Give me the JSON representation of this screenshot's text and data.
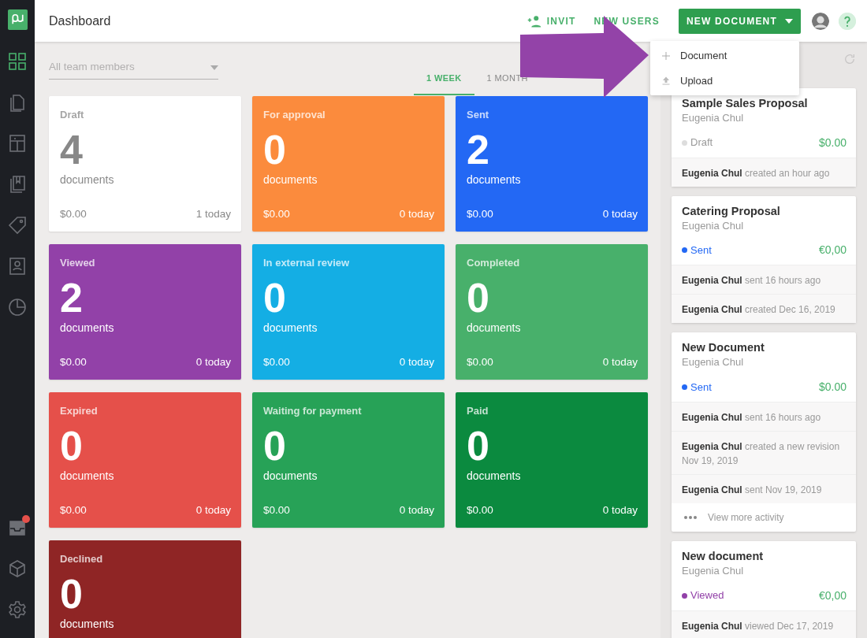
{
  "header": {
    "title": "Dashboard",
    "invite_button": {
      "parts": [
        "INVIT",
        "NEW USERS"
      ]
    },
    "new_document_button": {
      "label": "NEW DOCUMENT"
    }
  },
  "new_document_menu": [
    {
      "label": "Document",
      "kind": "plus"
    },
    {
      "label": "Upload",
      "kind": "upload"
    }
  ],
  "sidebar": {
    "items": [
      {
        "kind": "grid",
        "selected": true
      },
      {
        "kind": "document",
        "selected": false
      },
      {
        "kind": "template",
        "selected": false
      },
      {
        "kind": "library",
        "selected": false
      },
      {
        "kind": "tag",
        "selected": false
      },
      {
        "kind": "contacts",
        "selected": false
      },
      {
        "kind": "chart",
        "selected": false
      }
    ],
    "bottom_items": [
      {
        "kind": "inbox",
        "notification": true
      },
      {
        "kind": "cube",
        "notification": false
      },
      {
        "kind": "gear",
        "notification": false
      }
    ]
  },
  "filter": {
    "placeholder": "All team members"
  },
  "period_tabs": [
    {
      "label": "1 WEEK",
      "selected": true
    },
    {
      "label": "1 MONTH",
      "selected": false
    }
  ],
  "tiles": [
    {
      "label": "Draft",
      "count": "4",
      "unit": "documents",
      "amount": "$0.00",
      "today": "1 today",
      "color": "#ffffff"
    },
    {
      "label": "For approval",
      "count": "0",
      "unit": "documents",
      "amount": "$0.00",
      "today": "0 today",
      "color": "#fb8b3d"
    },
    {
      "label": "Sent",
      "count": "2",
      "unit": "documents",
      "amount": "$0.00",
      "today": "0 today",
      "color": "#2368f4"
    },
    {
      "label": "Viewed",
      "count": "2",
      "unit": "documents",
      "amount": "$0.00",
      "today": "0 today",
      "color": "#9241a8"
    },
    {
      "label": "In external review",
      "count": "0",
      "unit": "documents",
      "amount": "$0.00",
      "today": "0 today",
      "color": "#14aee4"
    },
    {
      "label": "Completed",
      "count": "0",
      "unit": "documents",
      "amount": "$0.00",
      "today": "0 today",
      "color": "#48b06b"
    },
    {
      "label": "Expired",
      "count": "0",
      "unit": "documents",
      "amount": "$0.00",
      "today": "0 today",
      "color": "#e5504a"
    },
    {
      "label": "Waiting for payment",
      "count": "0",
      "unit": "documents",
      "amount": "$0.00",
      "today": "0 today",
      "color": "#27a257"
    },
    {
      "label": "Paid",
      "count": "0",
      "unit": "documents",
      "amount": "$0.00",
      "today": "0 today",
      "color": "#0b8a3f"
    },
    {
      "label": "Declined",
      "count": "0",
      "unit": "documents",
      "color": "#8f2525"
    }
  ],
  "activity_cards": [
    {
      "title": "Sample Sales Proposal",
      "author": "Eugenia Chul",
      "status": {
        "label": "Draft",
        "color": "#dddddd"
      },
      "amount": "$0.00",
      "activities": [
        "**Eugenia Chul** created an hour ago"
      ]
    },
    {
      "title": "Catering Proposal",
      "author": "Eugenia Chul",
      "status": {
        "label": "Sent",
        "color": "#2368f4"
      },
      "amount": "€0,00",
      "activities": [
        "**Eugenia Chul** sent 16 hours ago",
        "**Eugenia Chul** created Dec 16, 2019"
      ]
    },
    {
      "title": "New Document",
      "author": "Eugenia Chul",
      "status": {
        "label": "Sent",
        "color": "#2368f4"
      },
      "amount": "$0.00",
      "activities": [
        "**Eugenia Chul** sent 16 hours ago",
        "**Eugenia Chul** created a new revision Nov 19, 2019",
        "**Eugenia Chul** sent Nov 19, 2019"
      ],
      "more": "View more activity"
    },
    {
      "title": "New document",
      "author": "Eugenia Chul",
      "status": {
        "label": "Viewed",
        "color": "#9241a8"
      },
      "amount": "€0,00",
      "activities": [
        "**Eugenia Chul** viewed Dec 17, 2019"
      ]
    }
  ]
}
